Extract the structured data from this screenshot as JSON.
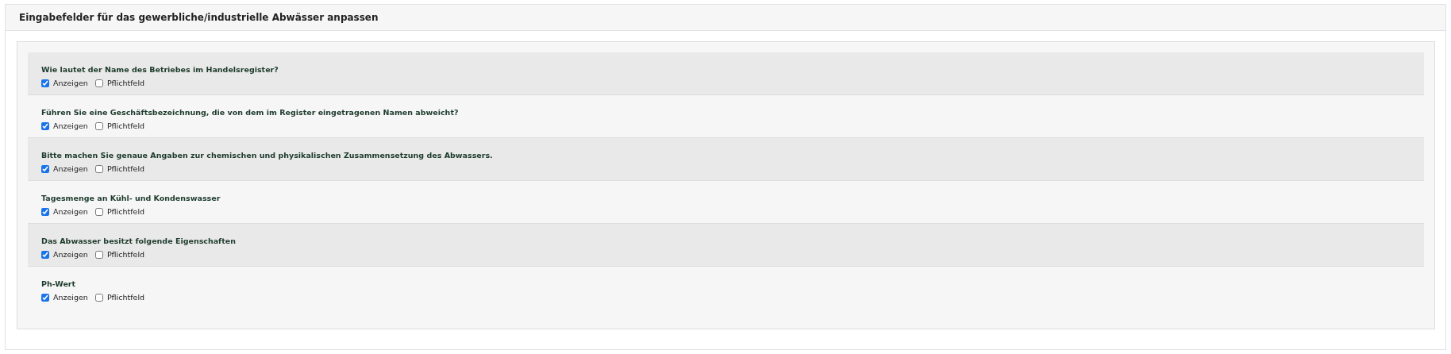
{
  "panel": {
    "title": "Eingabefelder für das gewerbliche/industrielle Abwässer anpassen"
  },
  "fields": [
    {
      "question": "Wie lautet der Name des Betriebes im Handelsregister?",
      "options": [
        {
          "label": "Anzeigen",
          "checked": true
        },
        {
          "label": "Pflichtfeld",
          "checked": false
        }
      ]
    },
    {
      "question": "Führen Sie eine Geschäftsbezeichnung, die von dem im Register eingetragenen Namen abweicht?",
      "options": [
        {
          "label": "Anzeigen",
          "checked": true
        },
        {
          "label": "Pflichtfeld",
          "checked": false
        }
      ]
    },
    {
      "question": "Bitte machen Sie genaue Angaben zur chemischen und physikalischen Zusammensetzung des Abwassers.",
      "options": [
        {
          "label": "Anzeigen",
          "checked": true
        },
        {
          "label": "Pflichtfeld",
          "checked": false
        }
      ]
    },
    {
      "question": "Tagesmenge an Kühl- und Kondenswasser",
      "options": [
        {
          "label": "Anzeigen",
          "checked": true
        },
        {
          "label": "Pflichtfeld",
          "checked": false
        }
      ]
    },
    {
      "question": "Das Abwasser besitzt folgende Eigenschaften",
      "options": [
        {
          "label": "Anzeigen",
          "checked": true
        },
        {
          "label": "Pflichtfeld",
          "checked": false
        }
      ]
    },
    {
      "question": "Ph-Wert",
      "options": [
        {
          "label": "Anzeigen",
          "checked": true
        },
        {
          "label": "Pflichtfeld",
          "checked": false
        }
      ]
    }
  ]
}
